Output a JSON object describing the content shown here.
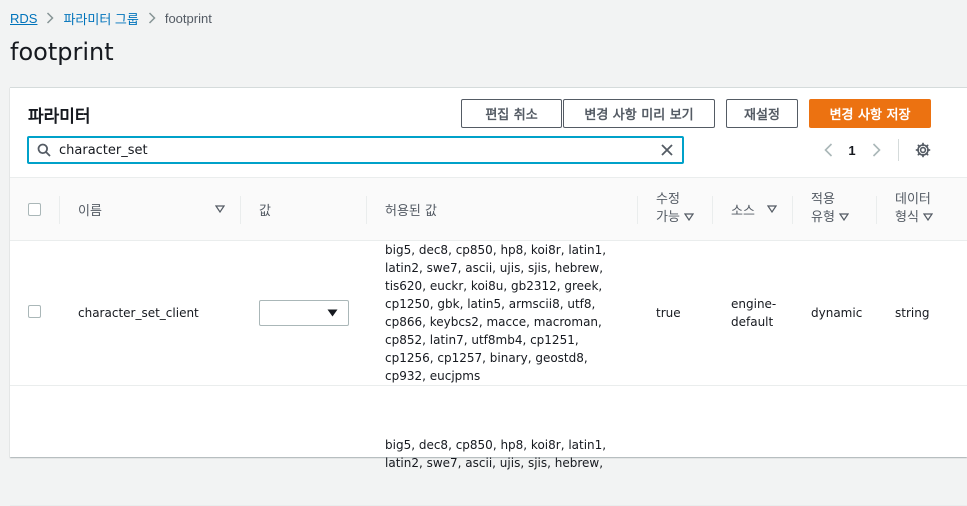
{
  "breadcrumb": {
    "items": [
      {
        "label": "RDS"
      },
      {
        "label": "파라미터 그룹"
      },
      {
        "label": "footprint"
      }
    ]
  },
  "page": {
    "title": "footprint"
  },
  "panel": {
    "title": "파라미터",
    "buttons": {
      "cancel_edit": "편집 취소",
      "preview_changes": "변경 사항 미리 보기",
      "reset": "재설정",
      "save_changes": "변경 사항 저장"
    },
    "search": {
      "value": "character_set",
      "placeholder": ""
    },
    "pagination": {
      "current_page": "1"
    }
  },
  "table": {
    "headers": {
      "name": "이름",
      "value": "값",
      "allowed_values": "허용된 값",
      "modifiable_line1": "수정",
      "modifiable_line2": "가능",
      "source": "소스",
      "apply_type_line1": "적용",
      "apply_type_line2": "유형",
      "data_type_line1": "데이터",
      "data_type_line2": "형식"
    },
    "rows": [
      {
        "name": "character_set_client",
        "value": "",
        "allowed_values": "big5, dec8, cp850, hp8, koi8r, latin1, latin2, swe7, ascii, ujis, sjis, hebrew, tis620, euckr, koi8u, gb2312, greek, cp1250, gbk, latin5, armscii8, utf8, cp866, keybcs2, macce, macroman, cp852, latin7, utf8mb4, cp1251, cp1256, cp1257, binary, geostd8, cp932, eucjpms",
        "modifiable": "true",
        "source_line1": "engine-",
        "source_line2": "default",
        "apply_type": "dynamic",
        "data_type": "string"
      },
      {
        "allowed_values": "big5, dec8, cp850, hp8, koi8r, latin1, latin2, swe7, ascii, ujis, sjis, hebrew,"
      }
    ]
  },
  "colors": {
    "primary": "#ec7211",
    "link": "#0073bb",
    "focus": "#00a1c9",
    "background": "#f2f3f3"
  }
}
